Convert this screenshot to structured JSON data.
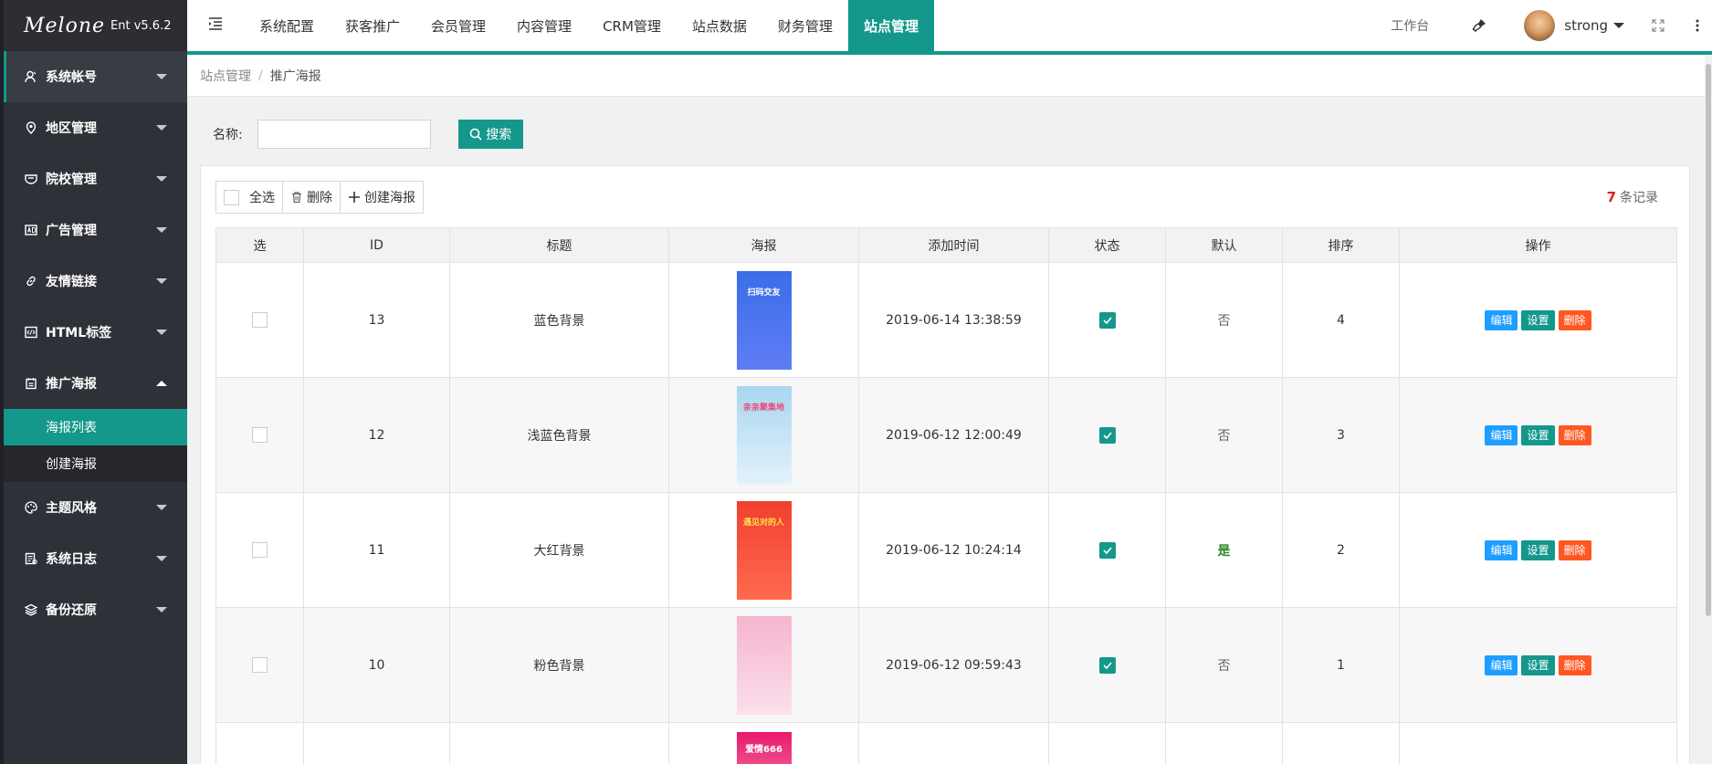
{
  "app": {
    "logo_mark": "Melone",
    "version": "Ent v5.6.2"
  },
  "sidebar": {
    "items": [
      {
        "label": "系统帐号",
        "icon": "user-icon"
      },
      {
        "label": "地区管理",
        "icon": "location-icon"
      },
      {
        "label": "院校管理",
        "icon": "school-icon"
      },
      {
        "label": "广告管理",
        "icon": "ad-icon"
      },
      {
        "label": "友情链接",
        "icon": "link-icon"
      },
      {
        "label": "HTML标签",
        "icon": "code-icon"
      },
      {
        "label": "推广海报",
        "icon": "poster-icon",
        "open": true
      },
      {
        "label": "主题风格",
        "icon": "palette-icon"
      },
      {
        "label": "系统日志",
        "icon": "log-icon"
      },
      {
        "label": "备份还原",
        "icon": "layers-icon"
      }
    ],
    "poster_sub": [
      {
        "label": "海报列表",
        "active": true
      },
      {
        "label": "创建海报",
        "active": false
      }
    ]
  },
  "topbar": {
    "tabs": [
      "系统配置",
      "获客推广",
      "会员管理",
      "内容管理",
      "CRM管理",
      "站点数据",
      "财务管理",
      "站点管理"
    ],
    "active_tab": "站点管理",
    "workbench": "工作台",
    "username": "strong"
  },
  "breadcrumb": {
    "parent": "站点管理",
    "separator": "/",
    "current": "推广海报"
  },
  "search": {
    "label": "名称:",
    "value": "",
    "placeholder": "",
    "button": "搜索"
  },
  "toolbar": {
    "select_all": "全选",
    "delete": "删除",
    "create": "创建海报"
  },
  "records": {
    "count": "7",
    "suffix": "条记录"
  },
  "table": {
    "headers": [
      "选",
      "ID",
      "标题",
      "海报",
      "添加时间",
      "状态",
      "默认",
      "排序",
      "操作"
    ],
    "rows": [
      {
        "id": "13",
        "title": "蓝色背景",
        "poster_text": "扫码交友",
        "poster_colors": [
          "#3a6ee8",
          "#5f7df5"
        ],
        "time": "2019-06-14 13:38:59",
        "status": true,
        "default": "否",
        "is_default": false,
        "sort": "4"
      },
      {
        "id": "12",
        "title": "浅蓝色背景",
        "poster_text": "亲亲聚集地",
        "poster_colors": [
          "#a9d6f0",
          "#e3f2fb"
        ],
        "time": "2019-06-12 12:00:49",
        "status": true,
        "default": "否",
        "is_default": false,
        "sort": "3"
      },
      {
        "id": "11",
        "title": "大红背景",
        "poster_text": "遇见对的人",
        "poster_colors": [
          "#f0402f",
          "#ff6a4d"
        ],
        "time": "2019-06-12 10:24:14",
        "status": true,
        "default": "是",
        "is_default": true,
        "sort": "2"
      },
      {
        "id": "10",
        "title": "粉色背景",
        "poster_text": "",
        "poster_colors": [
          "#f5b4cf",
          "#fbe0ec"
        ],
        "time": "2019-06-12 09:59:43",
        "status": true,
        "default": "否",
        "is_default": false,
        "sort": "1"
      }
    ],
    "partial_poster_text": "爱情666",
    "partial_poster_colors": [
      "#e8196b",
      "#f0508e"
    ],
    "actions": {
      "edit": "编辑",
      "set": "设置",
      "delete": "删除"
    }
  },
  "colors": {
    "accent": "#14988b",
    "sidebar_bg": "#2f3138",
    "edit_btn": "#1e9fff",
    "delete_btn": "#ff5722",
    "count_red": "#e02020"
  }
}
